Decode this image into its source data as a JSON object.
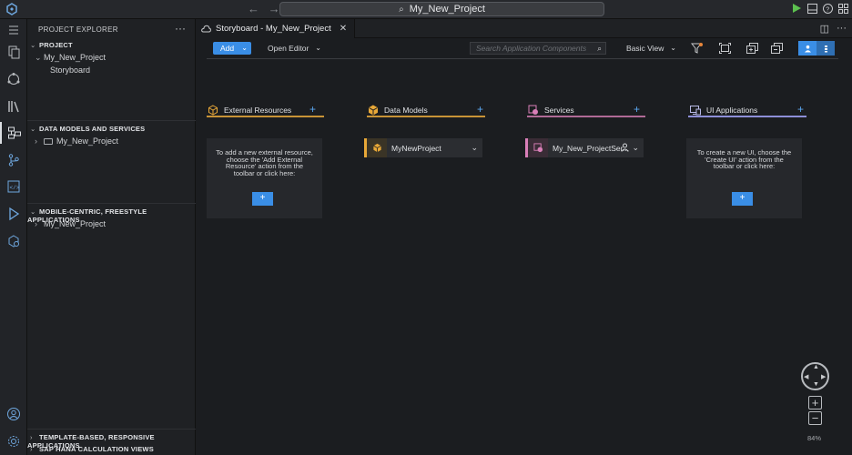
{
  "titlebar": {
    "search_text": "My_New_Project",
    "icons": [
      "app-logo",
      "back-arrow-icon",
      "forward-arrow-icon",
      "run-icon",
      "layout-panel-icon",
      "help-icon",
      "layout-toggle-icon"
    ]
  },
  "activitybar": {
    "icons": [
      "menu-icon",
      "explorer-files-icon",
      "git-icon",
      "library-icon",
      "storyboard-icon",
      "source-control-icon",
      "code-icon",
      "run-debug-icon",
      "deploy-icon",
      "account-icon",
      "settings-icon"
    ],
    "active": "storyboard-icon"
  },
  "sidebar": {
    "title": "PROJECT EXPLORER",
    "sections": {
      "project": {
        "label": "PROJECT",
        "root": "My_New_Project",
        "child": "Storyboard"
      },
      "data_models": {
        "label": "DATA MODELS AND SERVICES",
        "item": "My_New_Project"
      },
      "mobile": {
        "label": "MOBILE-CENTRIC, FREESTYLE APPLICATIONS",
        "item": "My_New_Project"
      },
      "template": {
        "label": "TEMPLATE-BASED, RESPONSIVE APPLICATIONS"
      },
      "hana": {
        "label": "SAP HANA CALCULATION VIEWS"
      }
    }
  },
  "editor": {
    "tab_title": "Storyboard - My_New_Project",
    "toolbar": {
      "add_label": "Add",
      "open_editor_label": "Open Editor",
      "search_placeholder": "Search Application Components",
      "view_label": "Basic View"
    },
    "lanes": {
      "external": {
        "title": "External Resources",
        "accent": "#e8a838",
        "empty_text": "To add a new external resource, choose the 'Add External Resource' action from the toolbar or click here:",
        "button": "+"
      },
      "data_models": {
        "title": "Data Models",
        "accent": "#e8a838",
        "item": "MyNewProject"
      },
      "services": {
        "title": "Services",
        "accent": "#d97fb8",
        "item": "My_New_ProjectSer..."
      },
      "ui": {
        "title": "UI Applications",
        "accent": "#8e8fd8",
        "empty_text": "To create a new UI, choose the 'Create UI' action from the toolbar or click here:",
        "button": "+"
      }
    },
    "zoom": {
      "plus": "+",
      "minus": "−",
      "level": "84%"
    }
  }
}
